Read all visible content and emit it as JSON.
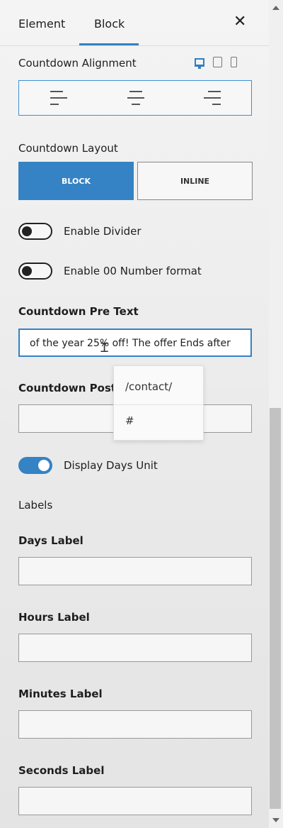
{
  "tabs": {
    "element": "Element",
    "block": "Block"
  },
  "close_glyph": "✕",
  "alignment": {
    "label": "Countdown Alignment",
    "options": [
      "left",
      "center",
      "right"
    ],
    "device_icons": [
      "desktop-icon",
      "tablet-icon",
      "mobile-icon"
    ]
  },
  "layout": {
    "label": "Countdown Layout",
    "block": "BLOCK",
    "inline": "INLINE",
    "selected": "BLOCK"
  },
  "toggles": {
    "divider": {
      "label": "Enable Divider",
      "on": false
    },
    "number_format": {
      "label": "Enable 00 Number format",
      "on": false
    },
    "days_unit": {
      "label": "Display Days Unit",
      "on": true
    }
  },
  "pre_text": {
    "label": "Countdown Pre Text",
    "value": "of the year 25% off! The offer Ends after"
  },
  "post_text": {
    "label": "Countdown Post Te",
    "value": ""
  },
  "dropdown": {
    "items": [
      "/contact/",
      "#"
    ]
  },
  "labels_section": "Labels",
  "days_label": {
    "label": "Days Label",
    "value": ""
  },
  "hours_label": {
    "label": "Hours Label",
    "value": ""
  },
  "minutes_label": {
    "label": "Minutes Label",
    "value": ""
  },
  "seconds_label": {
    "label": "Seconds Label",
    "value": ""
  },
  "accent_color": "#3582c4"
}
